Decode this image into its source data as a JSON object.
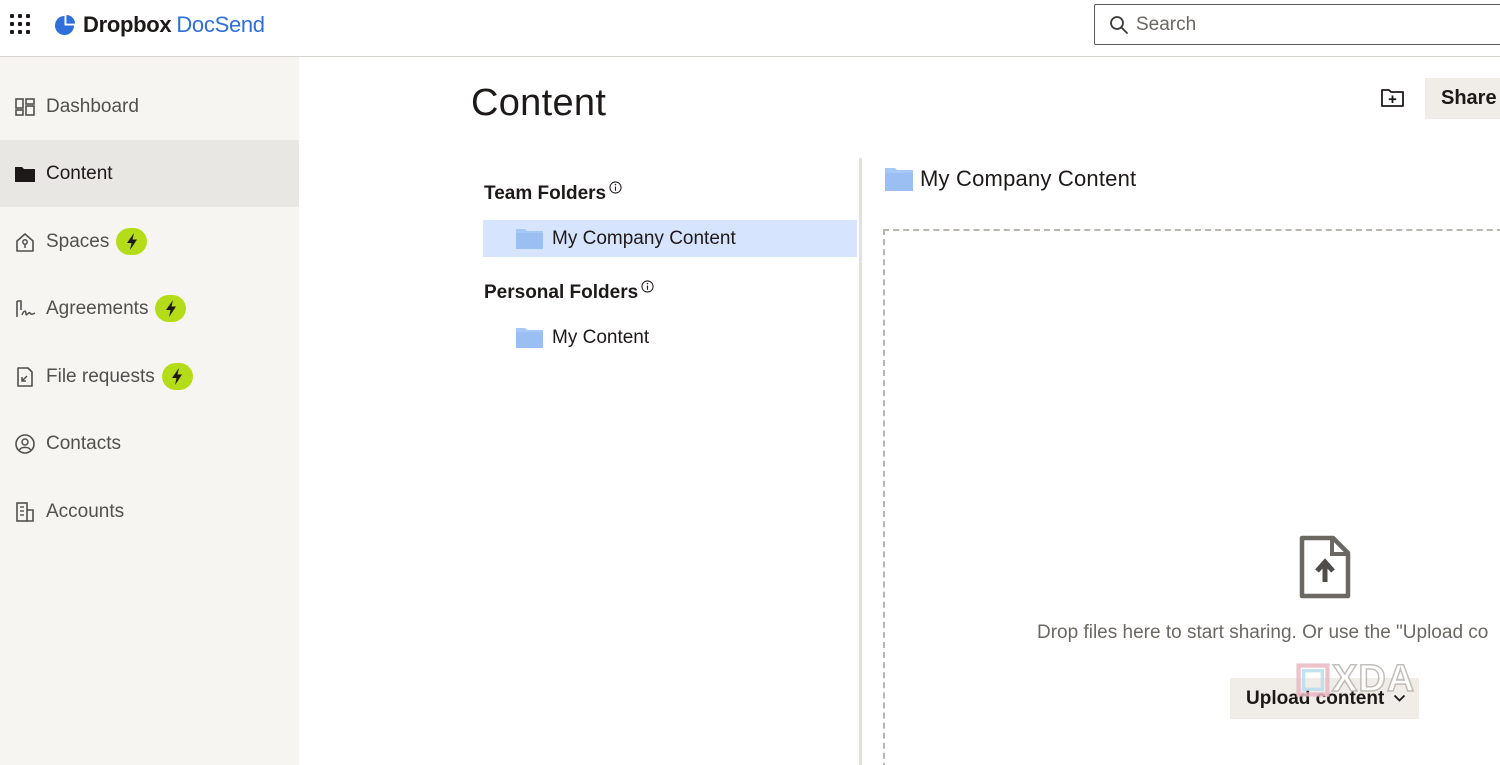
{
  "topbar": {
    "brand": "Dropbox",
    "product": "DocSend",
    "search_placeholder": "Search"
  },
  "sidebar": {
    "items": [
      {
        "label": "Dashboard",
        "icon": "dashboard-icon",
        "active": false,
        "badge": false
      },
      {
        "label": "Content",
        "icon": "folder-icon",
        "active": true,
        "badge": false
      },
      {
        "label": "Spaces",
        "icon": "spaces-icon",
        "active": false,
        "badge": true
      },
      {
        "label": "Agreements",
        "icon": "signature-icon",
        "active": false,
        "badge": true
      },
      {
        "label": "File requests",
        "icon": "file-request-icon",
        "active": false,
        "badge": true
      },
      {
        "label": "Contacts",
        "icon": "contact-icon",
        "active": false,
        "badge": false
      },
      {
        "label": "Accounts",
        "icon": "building-icon",
        "active": false,
        "badge": false
      }
    ]
  },
  "main": {
    "title": "Content",
    "share_label": "Share",
    "tree": {
      "team_heading": "Team Folders",
      "team_items": [
        {
          "label": "My Company Content",
          "selected": true
        }
      ],
      "personal_heading": "Personal Folders",
      "personal_items": [
        {
          "label": "My Content",
          "selected": false
        }
      ]
    },
    "folder": {
      "name": "My Company Content",
      "drop_text": "Drop files here to start sharing. Or use the \"Upload co",
      "upload_label": "Upload content"
    },
    "watermark": "XDA"
  },
  "colors": {
    "accent": "#2f6fdb",
    "badge": "#b4dc19",
    "selected": "#d6e5fd",
    "folder": "#a6c8f6"
  }
}
